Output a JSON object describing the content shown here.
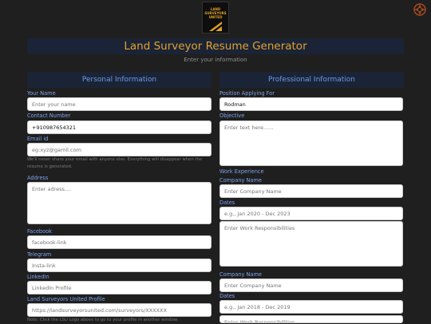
{
  "logo": {
    "text": "LAND SURVEYORS UNITED"
  },
  "header": {
    "title": "Land Surveyor Resume Generator",
    "subtitle": "Enter your information"
  },
  "personal": {
    "heading": "Personal Information",
    "name": {
      "label": "Your Name",
      "placeholder": "Enter your name"
    },
    "contact": {
      "label": "Contact Number",
      "value": "+910987654321"
    },
    "email": {
      "label": "Email id",
      "placeholder": "eg:xyz@gamil.com",
      "note": "We'll never share your email with anyone else. Everything will disappear when the resume is generated."
    },
    "address": {
      "label": "Address",
      "placeholder": "Enter adress...."
    },
    "facebook": {
      "label": "Facebook",
      "placeholder": "facebook-link"
    },
    "telegram": {
      "label": "Telegram",
      "placeholder": "Insta-link"
    },
    "linkedin": {
      "label": "LinkedIn",
      "placeholder": "LinkedIn Profile"
    },
    "lsu": {
      "label": "Land Surveyors United Profile",
      "placeholder": "https://landsurveyorsunited.com/surveyors/XXXXXX",
      "note": "Note: Click the LSU Logo above to go to your profile in another window."
    }
  },
  "professional": {
    "heading": "Professional Information",
    "position": {
      "label": "Position Applying For",
      "value": "Rodman"
    },
    "objective": {
      "label": "Objective",
      "placeholder": "Enter text here......"
    },
    "experience_label": "Work Experience",
    "jobs": [
      {
        "company_label": "Company Name",
        "company_placeholder": "Enter Company Name",
        "dates_label": "Dates",
        "dates_placeholder": "e.g., Jan 2020 - Dec 2023",
        "resp_placeholder": "Enter Work Responsibilities"
      },
      {
        "company_label": "Company Name",
        "company_placeholder": "Enter Company Name",
        "dates_label": "Dates",
        "dates_placeholder": "e.g., Jan 2018 - Dec 2019",
        "resp_placeholder": "Enter Work Responsibilities"
      }
    ]
  },
  "colors": {
    "background": "#1f1f1f",
    "panel": "#1b2436",
    "accent": "#e3a12d",
    "label": "#7da4ec"
  },
  "icons": {
    "corner": "compass-cross-icon"
  }
}
